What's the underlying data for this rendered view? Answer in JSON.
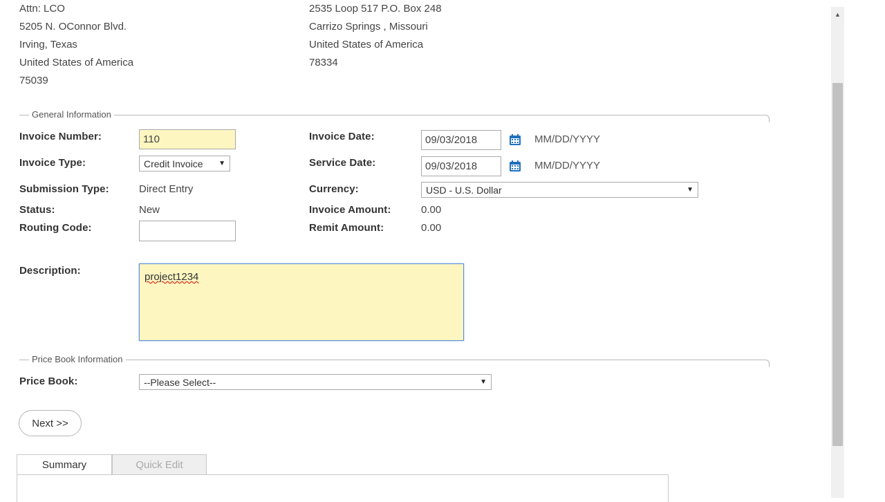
{
  "bill_to_address": [
    "Attn:  LCO",
    "5205 N. OConnor Blvd.",
    "Irving, Texas",
    "United States of America",
    "75039"
  ],
  "remit_to_address": [
    "2535 Loop 517 P.O. Box 248",
    "Carrizo Springs ,  Missouri",
    "United States of America",
    "78334"
  ],
  "general_info": {
    "legend": "General Information",
    "invoice_number": {
      "label": "Invoice Number:",
      "value": "110"
    },
    "invoice_type": {
      "label": "Invoice Type:",
      "value": "Credit Invoice"
    },
    "submission_type": {
      "label": "Submission Type:",
      "value": "Direct Entry"
    },
    "status": {
      "label": "Status:",
      "value": "New"
    },
    "routing_code": {
      "label": "Routing Code:",
      "value": ""
    },
    "invoice_date": {
      "label": "Invoice Date:",
      "value": "09/03/2018",
      "format_hint": "MM/DD/YYYY"
    },
    "service_date": {
      "label": "Service Date:",
      "value": "09/03/2018",
      "format_hint": "MM/DD/YYYY"
    },
    "currency": {
      "label": "Currency:",
      "value": "USD - U.S. Dollar"
    },
    "invoice_amount": {
      "label": "Invoice Amount:",
      "value": "0.00"
    },
    "remit_amount": {
      "label": "Remit Amount:",
      "value": "0.00"
    },
    "description": {
      "label": "Description:",
      "value": "project1234"
    }
  },
  "price_book_info": {
    "legend": "Price Book Information",
    "price_book": {
      "label": "Price Book:",
      "value": "--Please Select--"
    }
  },
  "buttons": {
    "next": "Next >>"
  },
  "tabs": [
    {
      "label": "Summary",
      "active": true
    },
    {
      "label": "Quick Edit",
      "active": false
    }
  ],
  "colors": {
    "required_field_bg": "#fdf6c0",
    "calendar_icon": "#1f6fbf",
    "focus_border": "#5b8fd6"
  },
  "icons": {
    "calendar": "calendar-icon",
    "dropdown": "chevron-down-icon"
  }
}
